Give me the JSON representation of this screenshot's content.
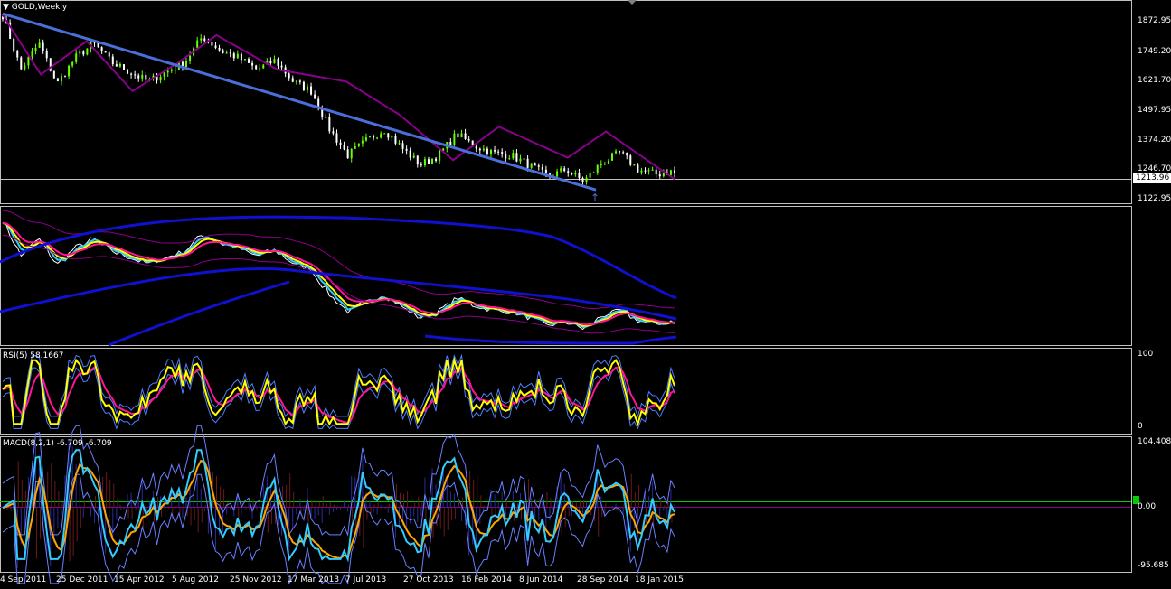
{
  "main": {
    "title": "GOLD,Weekly",
    "current_price": "1213.96",
    "price_axis": [
      "1872.95",
      "1749.20",
      "1621.70",
      "1497.95",
      "1374.20",
      "1246.70",
      "1122.95"
    ]
  },
  "bands": {},
  "rsi": {
    "label": "RSI(5) 58.1667",
    "axis_top": "100",
    "axis_bottom": "0"
  },
  "macd": {
    "label": "MACD(8,2,1) -6.709 -6.709",
    "axis_top": "104.408",
    "axis_mid": "0.00",
    "axis_bottom": "-95.685"
  },
  "time_axis": [
    "4 Sep 2011",
    "25 Dec 2011",
    "15 Apr 2012",
    "5 Aug 2012",
    "25 Nov 2012",
    "17 Mar 2013",
    "7 Jul 2013",
    "27 Oct 2013",
    "16 Feb 2014",
    "8 Jun 2014",
    "28 Sep 2014",
    "18 Jan 2015"
  ],
  "colors": {
    "background": "#000000",
    "bull_candle": "#66ff00",
    "bear_candle": "#ffffff",
    "trendline": "#4a6fd9",
    "zigzag": "#8b008b",
    "band_blue": "#1010d0",
    "rsi_main": "#ffff00",
    "rsi_signal": "#ff1493",
    "macd_line": "#33ccff",
    "macd_signal": "#ffa500",
    "zero_line": "#00cc00"
  },
  "chart_data": [
    {
      "type": "candlestick",
      "title": "GOLD,Weekly",
      "xlabel": "",
      "ylabel": "",
      "ylim": [
        1100,
        1920
      ],
      "x_ticks": [
        "4 Sep 2011",
        "25 Dec 2011",
        "15 Apr 2012",
        "5 Aug 2012",
        "25 Nov 2012",
        "17 Mar 2013",
        "7 Jul 2013",
        "27 Oct 2013",
        "16 Feb 2014",
        "8 Jun 2014",
        "28 Sep 2014",
        "18 Jan 2015"
      ],
      "close_path": [
        1880,
        1650,
        1760,
        1590,
        1700,
        1760,
        1680,
        1640,
        1600,
        1640,
        1680,
        1790,
        1730,
        1700,
        1650,
        1690,
        1600,
        1560,
        1400,
        1290,
        1350,
        1400,
        1320,
        1250,
        1290,
        1380,
        1330,
        1300,
        1290,
        1250,
        1200,
        1230,
        1180,
        1260,
        1300,
        1230,
        1210,
        1225
      ],
      "last_price": 1213.96
    },
    {
      "type": "line",
      "title": "RSI(5) 58.1667",
      "ylim": [
        0,
        100
      ],
      "last_value": 58.1667
    },
    {
      "type": "line",
      "title": "MACD(8,2,1) -6.709 -6.709",
      "ylim": [
        -95.685,
        104.408
      ],
      "last_value": -6.709
    }
  ]
}
